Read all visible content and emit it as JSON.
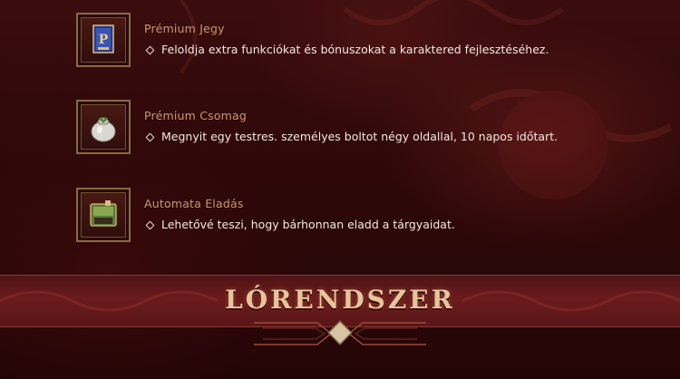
{
  "items": [
    {
      "title": "Prémium Jegy",
      "description": "Feloldja extra funkciókat és bónuszokat a karaktered fejlesztéséhez.",
      "icon": "premium-ticket-icon"
    },
    {
      "title": "Prémium Csomag",
      "description": "Megnyit egy testres. személyes boltot négy oldallal, 10 napos időtart.",
      "icon": "premium-bag-icon"
    },
    {
      "title": "Automata Eladás",
      "description": "Lehetővé teszi, hogy bárhonnan eladd a tárgyaidat.",
      "icon": "auto-sell-icon"
    }
  ],
  "section_title": "LÓRENDSZER",
  "colors": {
    "background": "#2a0709",
    "title_gold": "#c9986a",
    "banner_red": "#6a1b1c",
    "banner_text": "#e6c59a"
  }
}
